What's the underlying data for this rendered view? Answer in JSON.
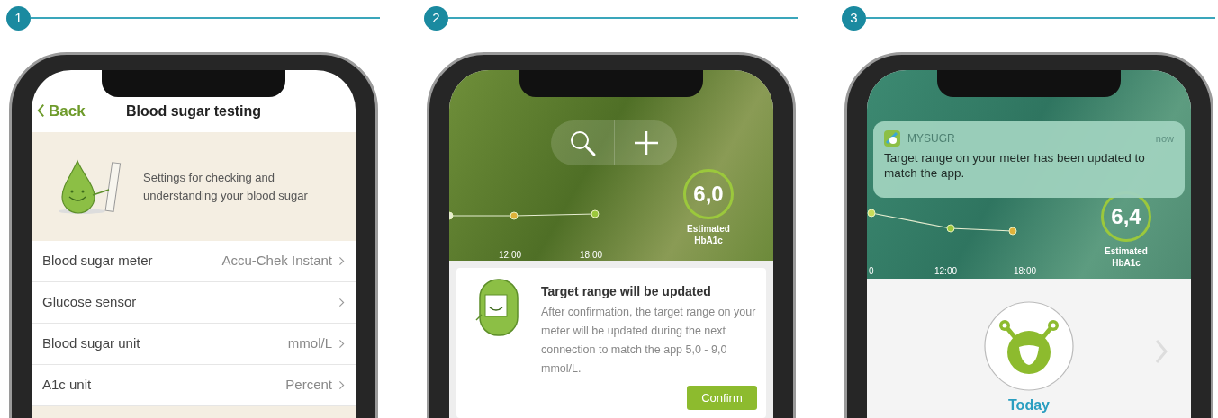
{
  "panels": [
    {
      "step": "1",
      "kind": "settings",
      "back": "Back",
      "title": "Blood sugar testing",
      "banner_text": "Settings for checking and understanding your blood sugar",
      "rows": [
        {
          "label": "Blood sugar meter",
          "value": "Accu-Chek Instant"
        },
        {
          "label": "Glucose sensor"
        },
        {
          "label": "Blood sugar unit",
          "value": "mmol/L"
        },
        {
          "label": "A1c unit",
          "value": "Percent"
        }
      ]
    },
    {
      "step": "2",
      "kind": "card",
      "x_labels": [
        "12:00",
        "18:00"
      ],
      "hba1c": {
        "value": "6,0",
        "label": "Estimated HbA1c"
      },
      "card": {
        "title": "Target range will be updated",
        "body": "After confirmation, the target range on your meter will be updated during the next connection to match the app 5,0 - 9,0 mmol/L.",
        "button": "Confirm"
      }
    },
    {
      "step": "3",
      "kind": "notification",
      "notification": {
        "app": "MYSUGR",
        "time": "now",
        "message": "Target range on your meter has been updated to match the app."
      },
      "x_labels": [
        "0",
        "12:00",
        "18:00"
      ],
      "hba1c": {
        "value": "6,4",
        "label": "Estimated HbA1c"
      },
      "today": "Today"
    }
  ]
}
